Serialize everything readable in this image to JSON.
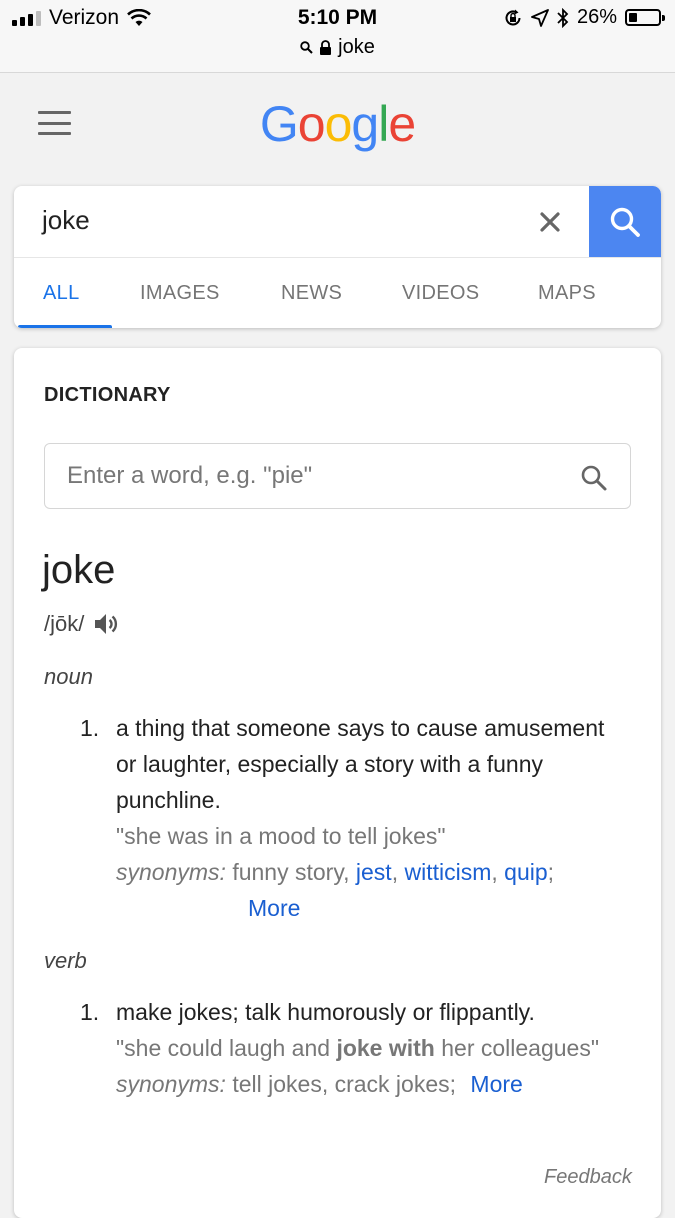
{
  "status": {
    "carrier": "Verizon",
    "time": "5:10 PM",
    "battery": "26%",
    "battery_level": 0.26,
    "url": "joke"
  },
  "logo": {
    "letters": [
      {
        "char": "G",
        "color": "#4285F4"
      },
      {
        "char": "o",
        "color": "#EA4335"
      },
      {
        "char": "o",
        "color": "#FBBC05"
      },
      {
        "char": "g",
        "color": "#4285F4"
      },
      {
        "char": "l",
        "color": "#34A853"
      },
      {
        "char": "e",
        "color": "#EA4335"
      }
    ]
  },
  "search": {
    "query": "joke",
    "tabs": [
      "ALL",
      "IMAGES",
      "NEWS",
      "VIDEOS",
      "MAPS"
    ],
    "active_tab": "ALL"
  },
  "dictionary": {
    "title": "DICTIONARY",
    "input_placeholder": "Enter a word, e.g. \"pie\"",
    "word": "joke",
    "pronunciation": "/jōk/",
    "noun": {
      "label": "noun",
      "number": "1.",
      "definition": "a thing that someone says to cause amusement or laughter, especially a story with a funny punchline.",
      "example": "\"she was in a mood to tell jokes\"",
      "synonyms_label": "synonyms:",
      "synonym_plain": "funny story,",
      "synonym_links": [
        "jest",
        "witticism",
        "quip"
      ],
      "more": "More"
    },
    "verb": {
      "label": "verb",
      "number": "1.",
      "definition": "make jokes; talk humorously or flippantly.",
      "example_pre": "\"she could laugh and ",
      "example_bold": "joke with",
      "example_post": " her colleagues\"",
      "synonyms_label": "synonyms:",
      "synonym_plain": "tell jokes, crack jokes;",
      "more": "More"
    },
    "feedback": "Feedback"
  },
  "colors": {
    "accent": "#1a73e8",
    "search_button": "#4c86f1",
    "link": "#1a5fd1"
  },
  "icons": [
    "signal-icon",
    "wifi-icon",
    "orientation-lock-icon",
    "location-icon",
    "bluetooth-icon",
    "battery-icon",
    "search-icon",
    "lock-icon",
    "menu-icon",
    "close-icon",
    "speaker-icon"
  ]
}
